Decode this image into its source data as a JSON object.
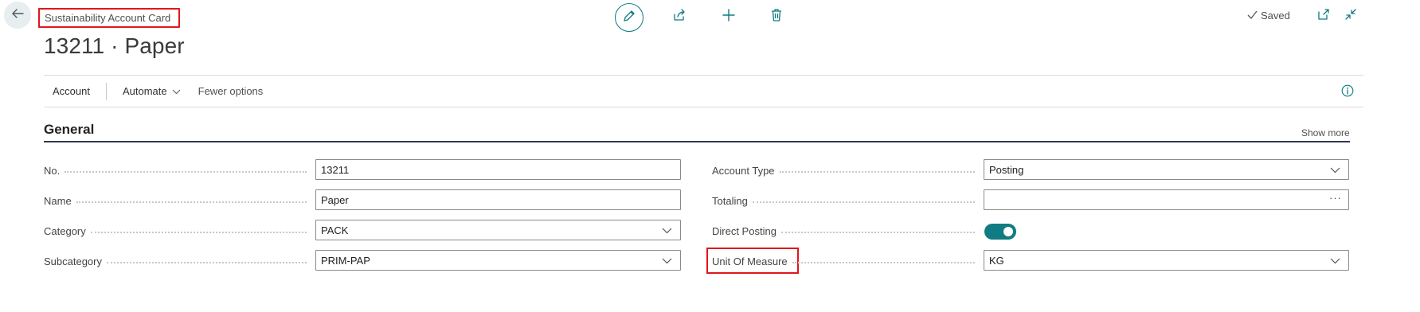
{
  "header": {
    "page_type": "Sustainability Account Card",
    "title": "13211 · Paper",
    "saved_label": "Saved"
  },
  "actions": {
    "account": "Account",
    "automate": "Automate",
    "fewer_options": "Fewer options"
  },
  "section": {
    "title": "General",
    "show_more": "Show more"
  },
  "fields": {
    "no": {
      "label": "No.",
      "value": "13211"
    },
    "name": {
      "label": "Name",
      "value": "Paper"
    },
    "category": {
      "label": "Category",
      "value": "PACK"
    },
    "subcategory": {
      "label": "Subcategory",
      "value": "PRIM-PAP"
    },
    "account_type": {
      "label": "Account Type",
      "value": "Posting"
    },
    "totaling": {
      "label": "Totaling",
      "value": ""
    },
    "direct_posting": {
      "label": "Direct Posting",
      "value": true
    },
    "unit_of_measure": {
      "label": "Unit Of Measure",
      "value": "KG"
    }
  },
  "colors": {
    "accent": "#0f7b83",
    "highlight": "#e0161c",
    "section_rule": "#2d3b50"
  },
  "icons": [
    "back-arrow-icon",
    "pencil-icon",
    "share-icon",
    "plus-icon",
    "trash-icon",
    "checkmark-icon",
    "open-new-window-icon",
    "collapse-icon",
    "chevron-down-icon",
    "info-icon",
    "ellipsis-icon"
  ]
}
